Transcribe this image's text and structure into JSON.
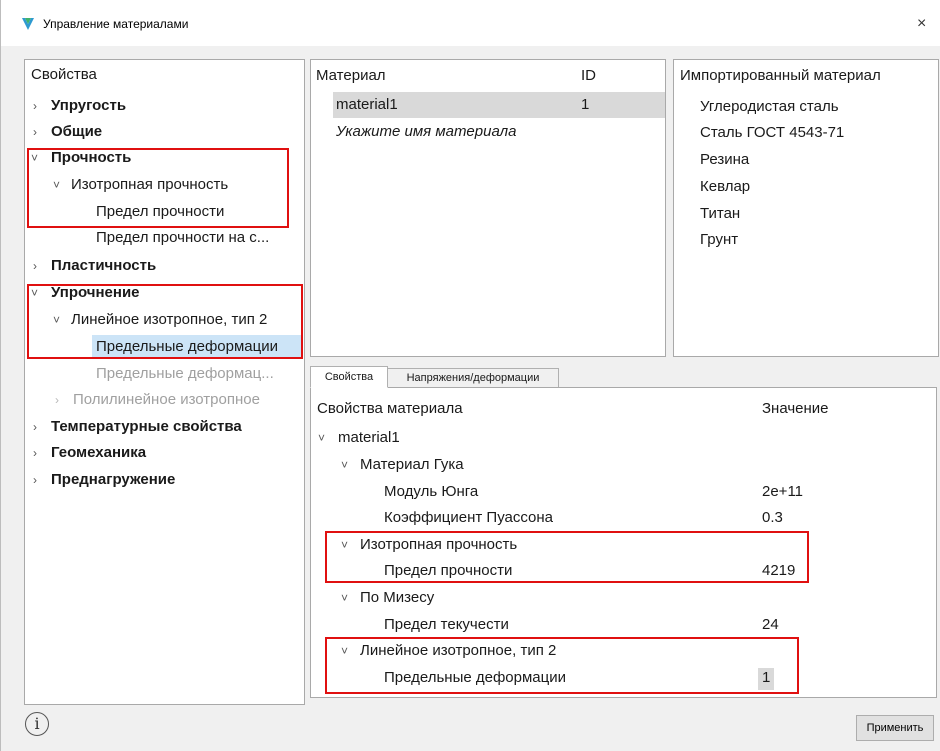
{
  "window": {
    "title": "Управление материалами",
    "close_glyph": "×"
  },
  "left_tree": {
    "header": "Свойства",
    "items": [
      {
        "label": "Упругость",
        "arrow": "›",
        "bold": true
      },
      {
        "label": "Общие",
        "arrow": "›",
        "bold": true
      },
      {
        "label": "Прочность",
        "arrow": "˅",
        "bold": true
      },
      {
        "label": "Изотропная прочность",
        "arrow": "˅"
      },
      {
        "label": "Предел прочности"
      },
      {
        "label": "Предел прочности на с..."
      },
      {
        "label": "Пластичность",
        "arrow": "›",
        "bold": true
      },
      {
        "label": "Упрочнение",
        "arrow": "˅",
        "bold": true
      },
      {
        "label": "Линейное изотропное, тип 2",
        "arrow": "˅"
      },
      {
        "label": "Предельные деформации",
        "selected": true
      },
      {
        "label": "Предельные деформац...",
        "disabled": true
      },
      {
        "label": "Полилинейное изотропное",
        "arrow": "›",
        "disabled": true
      },
      {
        "label": "Температурные свойства",
        "arrow": "›",
        "bold": true
      },
      {
        "label": "Геомеханика",
        "arrow": "›",
        "bold": true
      },
      {
        "label": "Преднагружение",
        "arrow": "›",
        "bold": true
      }
    ]
  },
  "materials": {
    "col_name": "Материал",
    "col_id": "ID",
    "rows": [
      {
        "name": "material1",
        "id": "1"
      }
    ],
    "placeholder": "Укажите имя материала"
  },
  "imported": {
    "header": "Импортированный материал",
    "items": [
      "Углеродистая сталь",
      "Сталь ГОСТ 4543-71",
      "Резина",
      "Кевлар",
      "Титан",
      "Грунт"
    ]
  },
  "tabs": [
    "Свойства",
    "Напряжения/деформации"
  ],
  "properties": {
    "col_prop": "Свойства материала",
    "col_value": "Значение",
    "rows": [
      {
        "label": "material1",
        "arrow": "˅",
        "value": ""
      },
      {
        "label": "Материал Гука",
        "arrow": "˅",
        "value": ""
      },
      {
        "label": "Модуль Юнга",
        "value": "2e+11"
      },
      {
        "label": "Коэффициент Пуассона",
        "value": "0.3"
      },
      {
        "label": "Изотропная прочность",
        "arrow": "˅",
        "value": ""
      },
      {
        "label": "Предел прочности",
        "value": "4219"
      },
      {
        "label": "По Мизесу",
        "arrow": "˅",
        "value": ""
      },
      {
        "label": "Предел текучести",
        "value": "24"
      },
      {
        "label": "Линейное изотропное, тип 2",
        "arrow": "˅",
        "value": ""
      },
      {
        "label": "Предельные деформации",
        "value": "1"
      }
    ]
  },
  "footer": {
    "info_glyph": "i",
    "apply_label": "Применить"
  },
  "colors": {
    "highlight": "#e01010",
    "selection": "#cce4f7"
  }
}
